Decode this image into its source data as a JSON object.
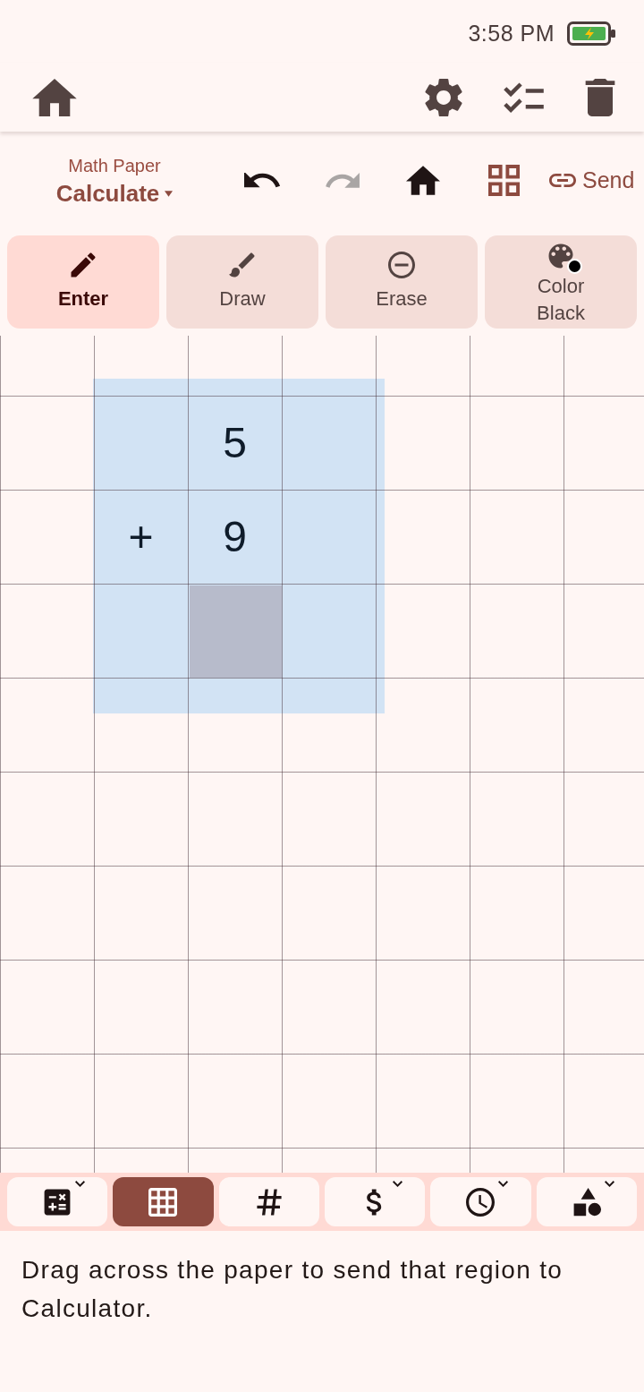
{
  "status_bar": {
    "time": "3:58 PM"
  },
  "toolbar": {
    "subtitle": "Math Paper",
    "title": "Calculate",
    "undo_disabled": false,
    "redo_disabled": true,
    "send_label": "Send"
  },
  "modes": [
    {
      "kind": "enter",
      "label": "Enter",
      "selected": true
    },
    {
      "kind": "draw",
      "label": "Draw",
      "selected": false
    },
    {
      "kind": "erase",
      "label": "Erase",
      "selected": false
    },
    {
      "kind": "color",
      "label": "Color",
      "value": "Black",
      "color": "#000000",
      "selected": false
    }
  ],
  "paper": {
    "selection_visible": true,
    "operands": [
      "5",
      "9"
    ],
    "operator": "+",
    "answer_cursor": true
  },
  "input_tabs": [
    {
      "kind": "calculator",
      "dropdown": true,
      "selected": false
    },
    {
      "kind": "grid",
      "dropdown": false,
      "selected": true
    },
    {
      "kind": "number",
      "dropdown": false,
      "selected": false
    },
    {
      "kind": "currency",
      "dropdown": true,
      "selected": false
    },
    {
      "kind": "time",
      "dropdown": true,
      "selected": false
    },
    {
      "kind": "shapes",
      "dropdown": true,
      "selected": false
    }
  ],
  "hint": "Drag across the paper to send that region to Calculator."
}
